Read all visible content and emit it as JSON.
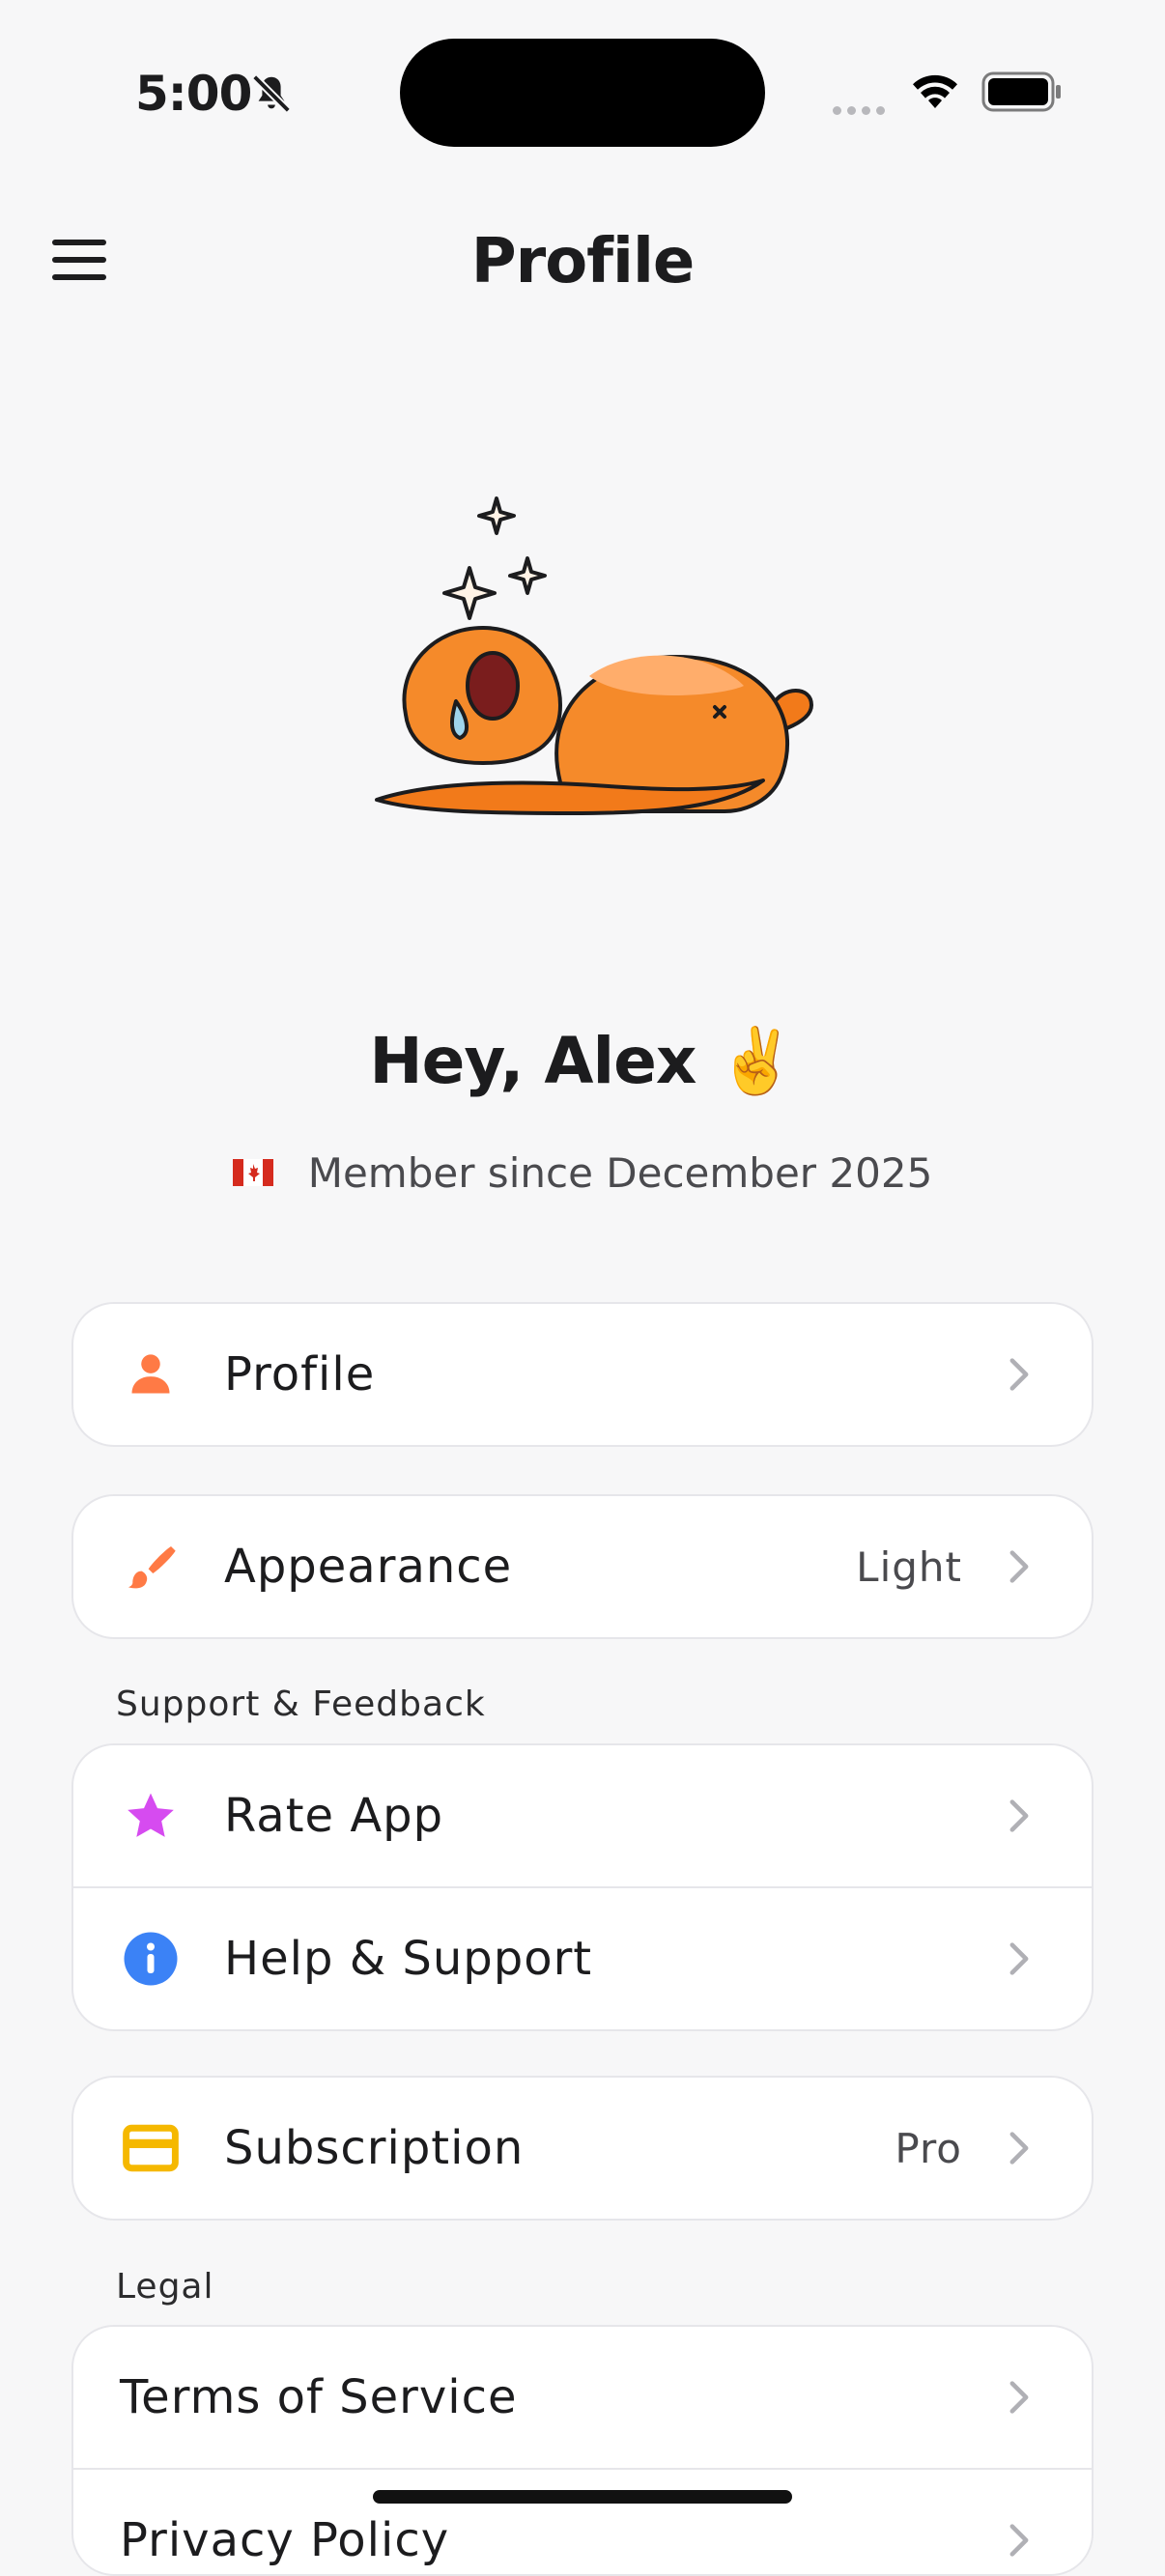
{
  "status_bar": {
    "time": "5:00"
  },
  "header": {
    "title": "Profile"
  },
  "profile": {
    "greeting": "Hey, Alex ✌️",
    "member_since": "Member since December 2025"
  },
  "menu": {
    "profile": {
      "label": "Profile"
    },
    "appearance": {
      "label": "Appearance",
      "value": "Light"
    },
    "support_section": "Support & Feedback",
    "rate_app": {
      "label": "Rate App"
    },
    "help": {
      "label": "Help & Support"
    },
    "subscription": {
      "label": "Subscription",
      "value": "Pro"
    },
    "legal_section": "Legal",
    "terms": {
      "label": "Terms of Service"
    },
    "privacy": {
      "label": "Privacy Policy"
    }
  },
  "colors": {
    "accent_orange": "#ff7a45",
    "star_magenta": "#d64bf0",
    "info_blue": "#3b82f6",
    "card_yellow": "#f5b800"
  }
}
